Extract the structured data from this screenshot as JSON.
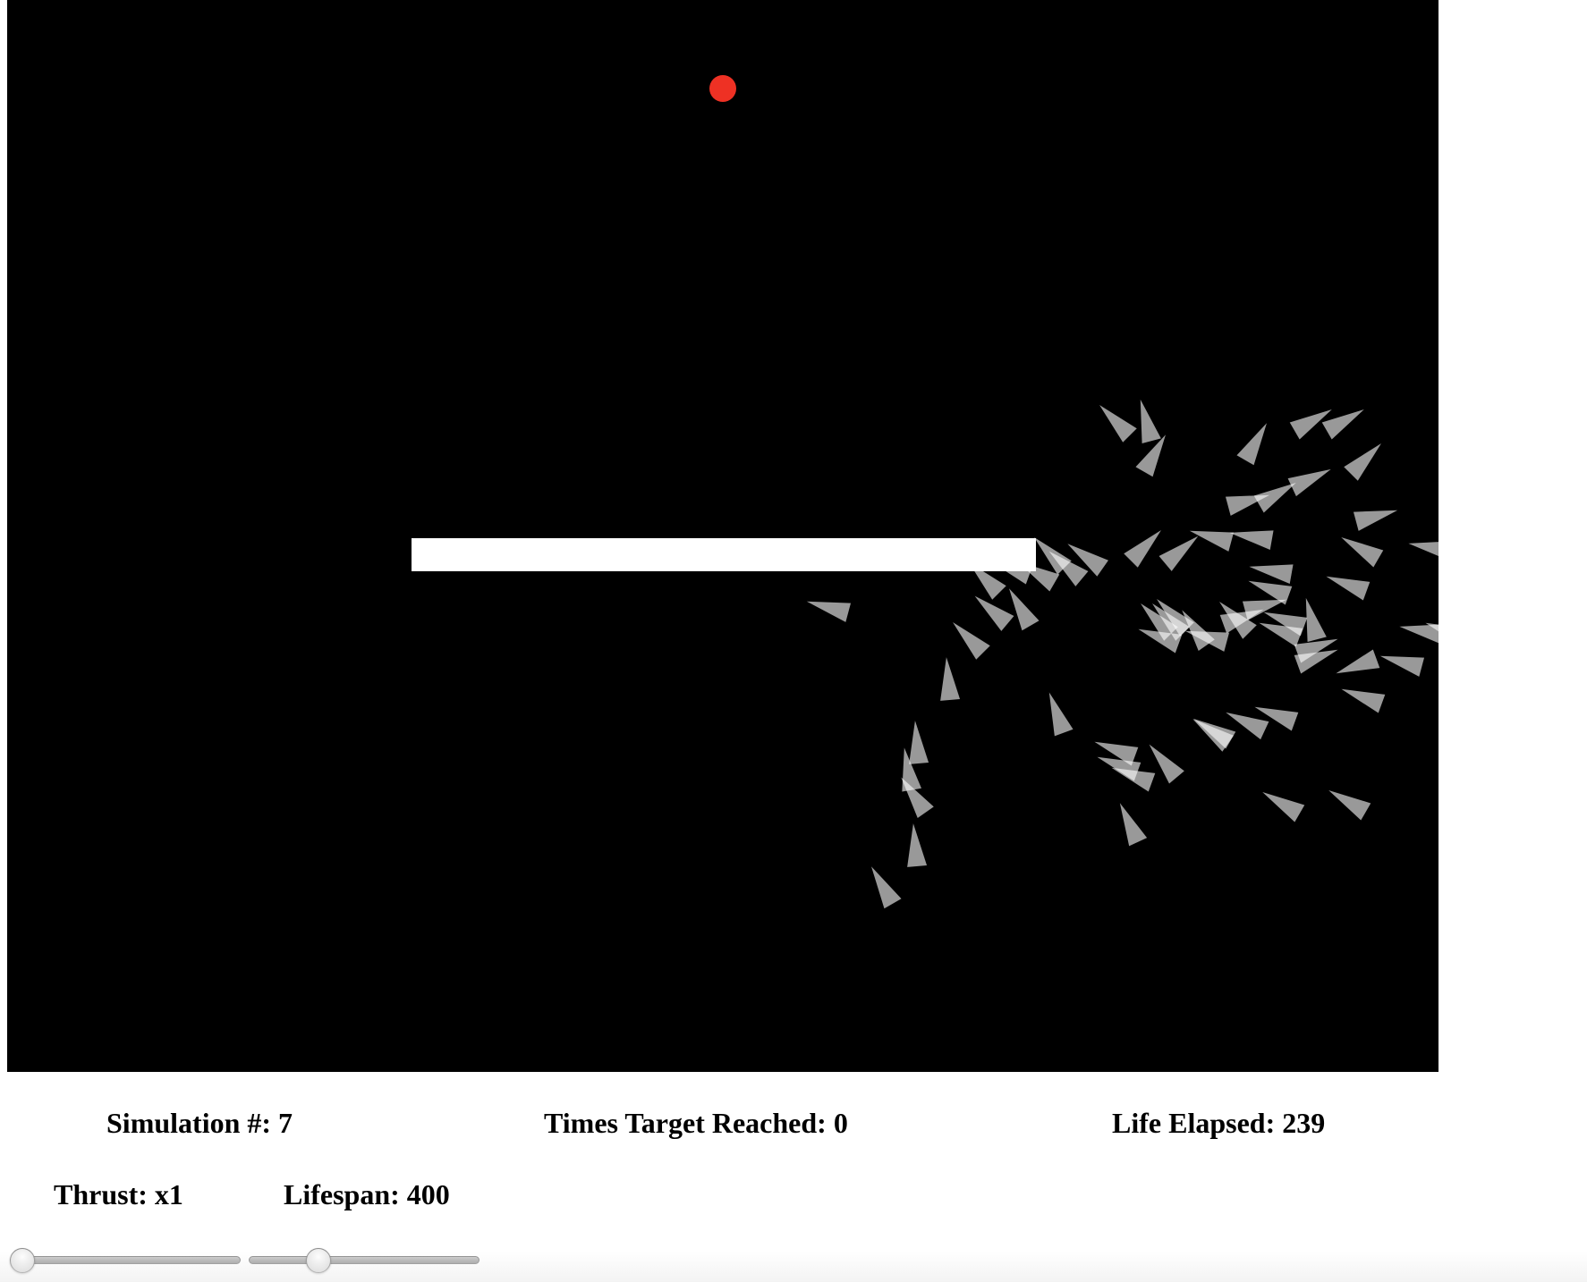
{
  "canvas": {
    "background_color": "#000000",
    "target_color": "#ee3124",
    "obstacle_color": "#ffffff",
    "rocket_color": "#ffffff"
  },
  "stats": {
    "simulation": "Simulation #: 7",
    "times_target_reached": "Times Target Reached: 0",
    "life_elapsed": "Life Elapsed: 239"
  },
  "controls": {
    "thrust_label": "Thrust: x1",
    "lifespan_label": "Lifespan: 400",
    "thrust_slider_fraction": 0.0,
    "lifespan_slider_fraction": 0.28
  }
}
